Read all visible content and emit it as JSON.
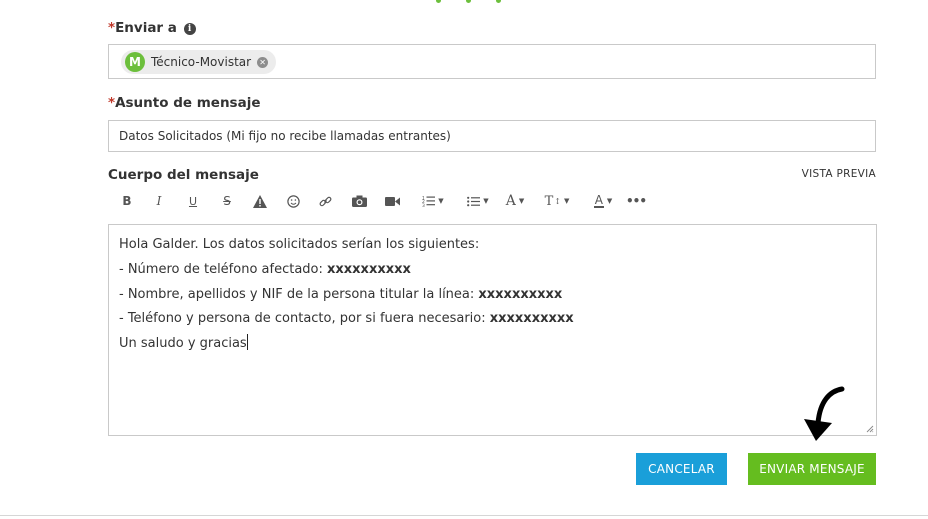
{
  "form": {
    "to_label": "Enviar a",
    "required_mark": "*",
    "recipient": {
      "name": "Técnico-Movistar",
      "avatar_letter": "M",
      "avatar_color": "#6cbf3c"
    },
    "subject_label": "Asunto de mensaje",
    "subject_value": "Datos Solicitados (Mi fijo no recibe llamadas entrantes)",
    "body_label": "Cuerpo del mensaje",
    "preview_link": "VISTA PREVIA"
  },
  "editor": {
    "lines": [
      {
        "text": "Hola Galder. Los datos solicitados serían los siguientes:",
        "bold": ""
      },
      {
        "text": "- Número de teléfono afectado: ",
        "bold": "xxxxxxxxxx"
      },
      {
        "text": "- Nombre, apellidos y NIF de la persona titular la línea: ",
        "bold": "xxxxxxxxxx"
      },
      {
        "text": "- Teléfono y persona de contacto, por si fuera necesario: ",
        "bold": "xxxxxxxxxx"
      },
      {
        "text": "Un saludo y gracias",
        "bold": ""
      }
    ]
  },
  "buttons": {
    "cancel_label": "CANCELAR",
    "send_label": "ENVIAR MENSAJE",
    "cancel_color": "#1a9fd9",
    "send_color": "#65bd1f"
  },
  "toolbar_icons": [
    "bold-icon",
    "italic-icon",
    "underline-icon",
    "strikethrough-icon",
    "warning-icon",
    "emoji-icon",
    "link-icon",
    "camera-icon",
    "video-icon",
    "ordered-list-icon",
    "unordered-list-icon",
    "font-family-icon",
    "font-size-icon",
    "font-color-icon",
    "more-icon"
  ]
}
